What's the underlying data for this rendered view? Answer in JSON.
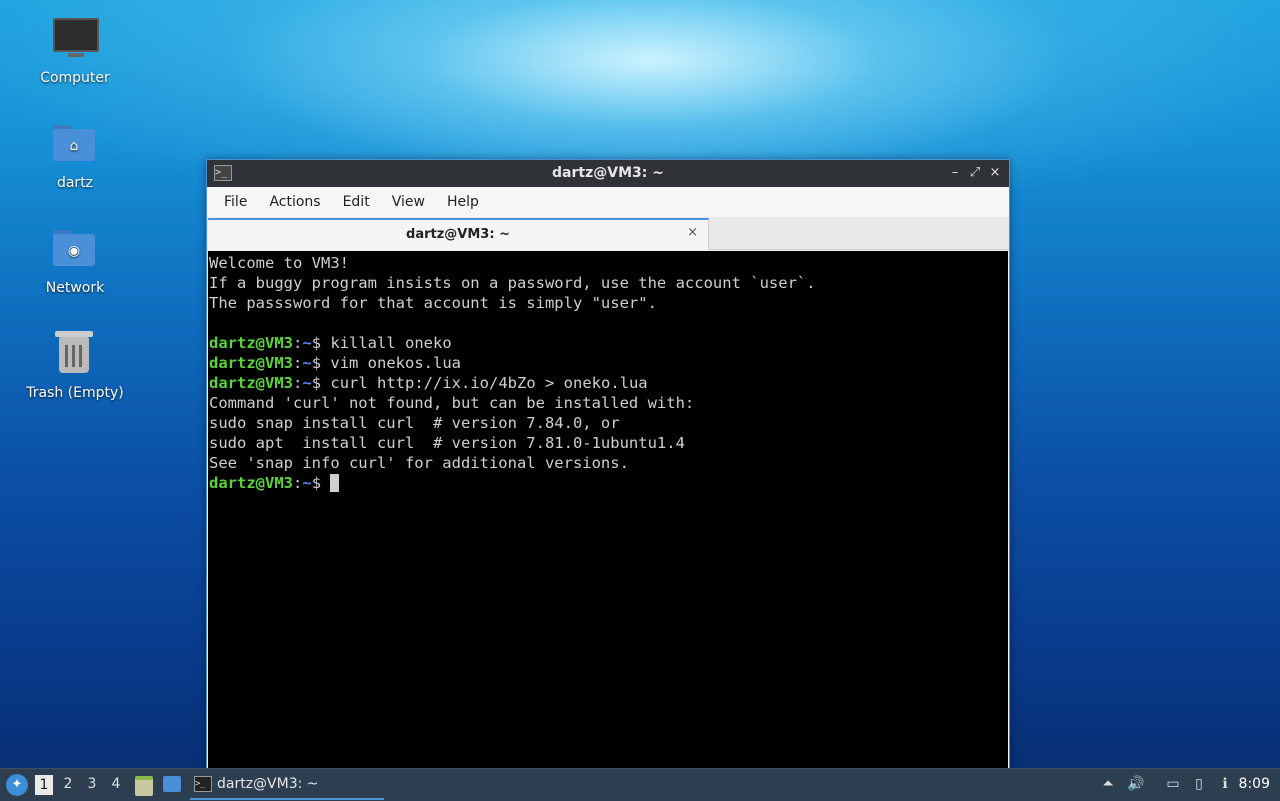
{
  "desktop": {
    "icons": [
      {
        "label": "Computer"
      },
      {
        "label": "dartz"
      },
      {
        "label": "Network"
      },
      {
        "label": "Trash (Empty)"
      }
    ]
  },
  "window": {
    "title": "dartz@VM3: ~",
    "menu": [
      "File",
      "Actions",
      "Edit",
      "View",
      "Help"
    ],
    "tab": {
      "label": "dartz@VM3: ~",
      "close": "×"
    },
    "buttons": {
      "minimize": "–",
      "maximize": "⤢",
      "close": "×"
    }
  },
  "terminal": {
    "prompt_user": "dartz@VM3",
    "prompt_sep": ":",
    "prompt_path": "~",
    "prompt_tail": "$ ",
    "lines": [
      {
        "type": "text",
        "text": "Welcome to VM3!"
      },
      {
        "type": "text",
        "text": "If a buggy program insists on a password, use the account `user`."
      },
      {
        "type": "text",
        "text": "The passsword for that account is simply \"user\"."
      },
      {
        "type": "text",
        "text": ""
      },
      {
        "type": "cmd",
        "text": "killall oneko"
      },
      {
        "type": "cmd",
        "text": "vim onekos.lua"
      },
      {
        "type": "cmd",
        "text": "curl http://ix.io/4bZo > oneko.lua"
      },
      {
        "type": "text",
        "text": "Command 'curl' not found, but can be installed with:"
      },
      {
        "type": "text",
        "text": "sudo snap install curl  # version 7.84.0, or"
      },
      {
        "type": "text",
        "text": "sudo apt  install curl  # version 7.81.0-1ubuntu1.4"
      },
      {
        "type": "text",
        "text": "See 'snap info curl' for additional versions."
      },
      {
        "type": "cursor",
        "text": ""
      }
    ]
  },
  "taskbar": {
    "workspaces": [
      "1",
      "2",
      "3",
      "4"
    ],
    "active_workspace": "1",
    "task_label": "dartz@VM3: ~",
    "clock": "8:09"
  }
}
